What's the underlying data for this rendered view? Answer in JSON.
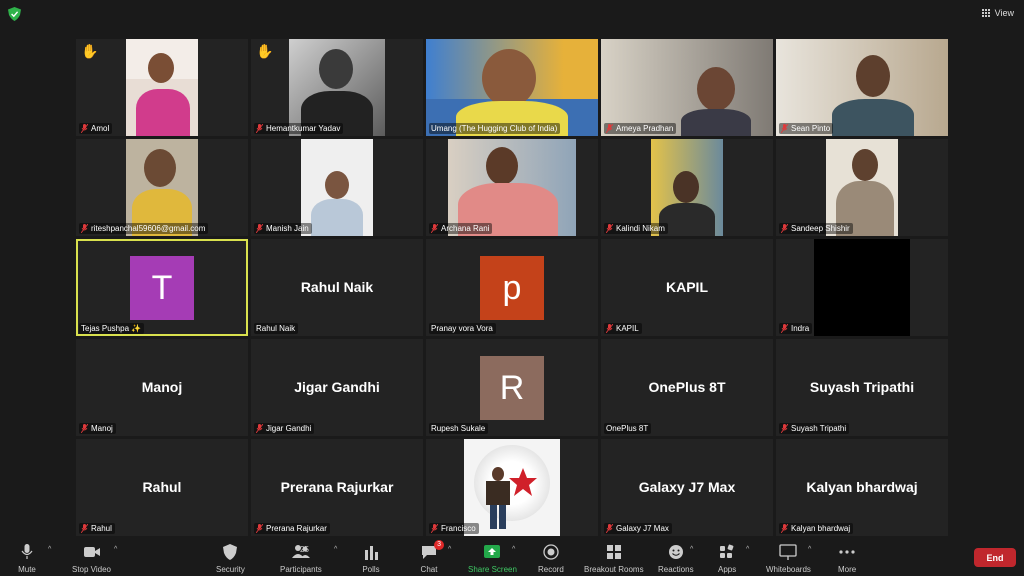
{
  "topbar": {
    "view_label": "View"
  },
  "tiles": [
    {
      "label": "Amol",
      "muted": true,
      "hand": true
    },
    {
      "label": "Hemantkumar Yadav",
      "muted": true,
      "hand": true
    },
    {
      "label": "Umang (The Hugging Club of India)",
      "muted": false
    },
    {
      "label": "Ameya Pradhan",
      "muted": true
    },
    {
      "label": "Sean Pinto",
      "muted": true
    },
    {
      "label": "riteshpanchal59606@gmail.com",
      "muted": true
    },
    {
      "label": "Manish Jain",
      "muted": true
    },
    {
      "label": "Archana Rani",
      "muted": true
    },
    {
      "label": "Kalindi Nikam",
      "muted": true
    },
    {
      "label": "Sandeep Shishir",
      "muted": true
    },
    {
      "label": "Tejas Pushpa ✨",
      "muted": false,
      "avatar": "T",
      "avatar_color": "#a53cb5"
    },
    {
      "label": "Rahul Naik",
      "muted": false,
      "big": "Rahul Naik"
    },
    {
      "label": "Pranay vora Vora",
      "muted": false,
      "avatar": "p",
      "avatar_color": "#c4421a"
    },
    {
      "label": "KAPIL",
      "muted": true,
      "big": "KAPIL"
    },
    {
      "label": "Indra",
      "muted": true
    },
    {
      "label": "Manoj",
      "muted": true,
      "big": "Manoj"
    },
    {
      "label": "Jigar Gandhi",
      "muted": true,
      "big": "Jigar Gandhi"
    },
    {
      "label": "Rupesh Sukale",
      "muted": false,
      "avatar": "R",
      "avatar_color": "#8c6b5e"
    },
    {
      "label": "OnePlus 8T",
      "muted": false,
      "big": "OnePlus 8T"
    },
    {
      "label": "Suyash Tripathi",
      "muted": true,
      "big": "Suyash Tripathi"
    },
    {
      "label": "Rahul",
      "muted": true,
      "big": "Rahul"
    },
    {
      "label": "Prerana Rajurkar",
      "muted": true,
      "big": "Prerana Rajurkar"
    },
    {
      "label": "Francisco",
      "muted": true
    },
    {
      "label": "Galaxy J7 Max",
      "muted": true,
      "big": "Galaxy J7 Max"
    },
    {
      "label": "Kalyan bhardwaj",
      "muted": true,
      "big": "Kalyan bhardwaj"
    }
  ],
  "toolbar": {
    "mute": "Mute",
    "stop_video": "Stop Video",
    "security": "Security",
    "participants": "Participants",
    "participants_count": "25",
    "polls": "Polls",
    "chat": "Chat",
    "chat_badge": "3",
    "share_screen": "Share Screen",
    "record": "Record",
    "breakout_rooms": "Breakout Rooms",
    "reactions": "Reactions",
    "apps": "Apps",
    "whiteboards": "Whiteboards",
    "more": "More",
    "end": "End"
  },
  "colors": {
    "active_outline": "#d9e14e",
    "share_green": "#23a84a",
    "end_red": "#c0272d",
    "muted_red": "#e0393b"
  }
}
